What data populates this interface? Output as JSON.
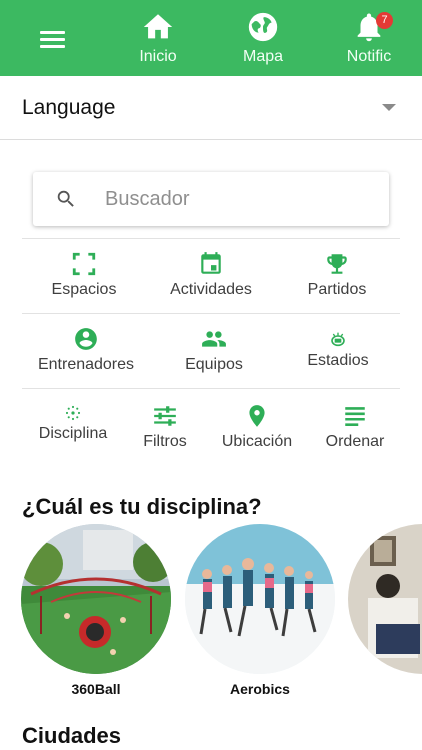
{
  "colors": {
    "brand": "#3cb961",
    "icon": "#2eae57",
    "badge": "#e53935"
  },
  "topbar": {
    "menu_icon": "hamburger-menu-icon",
    "nav": [
      {
        "label": "Inicio",
        "icon": "home-icon"
      },
      {
        "label": "Mapa",
        "icon": "globe-icon"
      },
      {
        "label": "Notific",
        "icon": "bell-icon",
        "badge": "7"
      }
    ]
  },
  "language": {
    "label": "Language",
    "icon": "dropdown-caret-icon"
  },
  "search": {
    "placeholder": "Buscador",
    "icon": "search-icon"
  },
  "categories": [
    {
      "label": "Espacios",
      "icon": "fullscreen-frame-icon"
    },
    {
      "label": "Actividades",
      "icon": "calendar-icon"
    },
    {
      "label": "Partidos",
      "icon": "trophy-icon"
    },
    {
      "label": "Entrenadores",
      "icon": "account-circle-icon"
    },
    {
      "label": "Equipos",
      "icon": "group-icon"
    },
    {
      "label": "Estadios",
      "icon": "stadium-icon"
    },
    {
      "label": "Disciplina",
      "icon": "sparkle-icon"
    },
    {
      "label": "Filtros",
      "icon": "sliders-icon"
    },
    {
      "label": "Ubicación",
      "icon": "location-pin-icon"
    },
    {
      "label": "Ordenar",
      "icon": "sort-lines-icon"
    }
  ],
  "disciplines": {
    "title": "¿Cuál es tu disciplina?",
    "items": [
      {
        "label": "360Ball"
      },
      {
        "label": "Aerobics"
      },
      {
        "label": ""
      }
    ]
  },
  "cities": {
    "title": "Ciudades"
  }
}
